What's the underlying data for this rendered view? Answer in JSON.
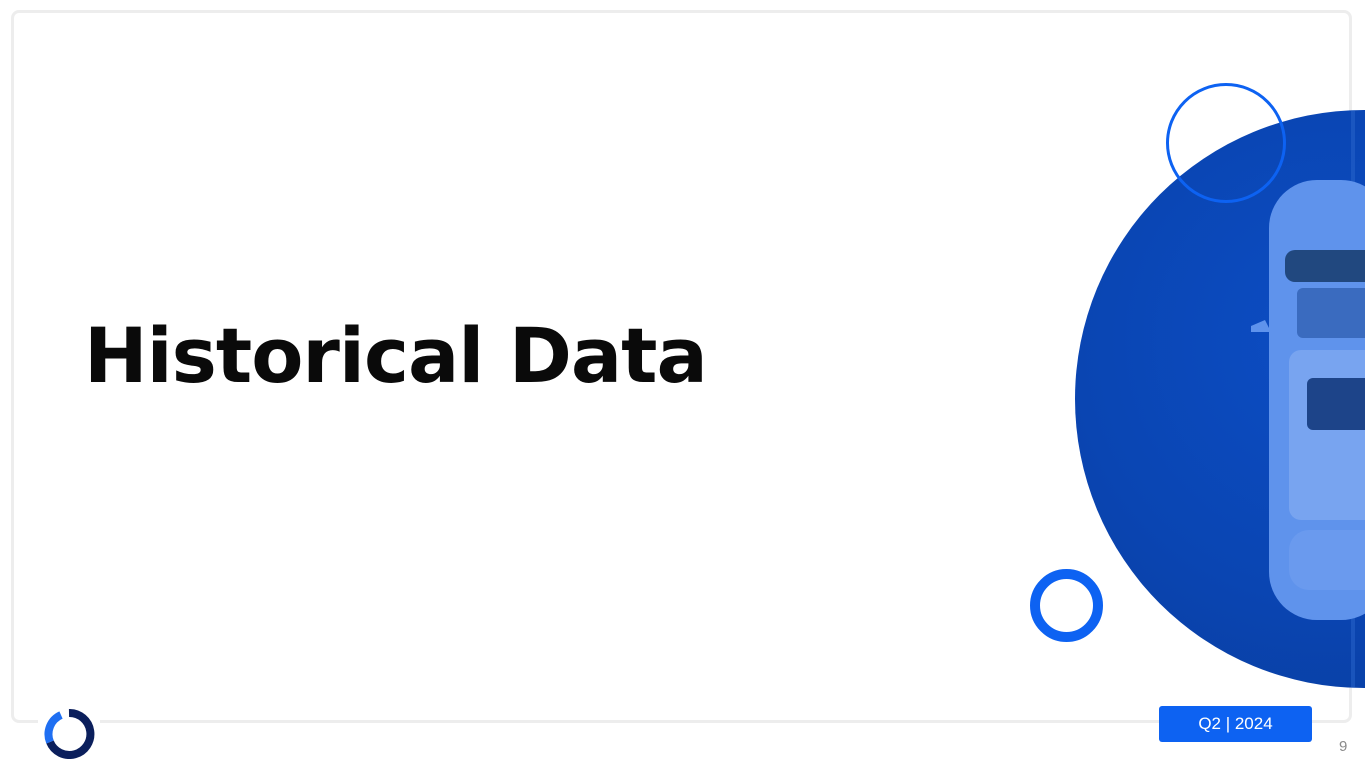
{
  "slide": {
    "title": "Historical Data",
    "badge_text": "Q2 | 2024",
    "page_number": "9"
  },
  "image": {
    "subject": "top-down view of a white car, blue duotone",
    "icon": "car-image"
  },
  "logo": {
    "icon": "circular-logo-icon"
  },
  "colors": {
    "accent": "#0d62f2",
    "photo_tint": "#0a45b2",
    "logo_dark": "#0b1f5c",
    "logo_light": "#1f6ff2",
    "title_text": "#0a0a0a",
    "page_number_text": "#8a8a8a"
  }
}
